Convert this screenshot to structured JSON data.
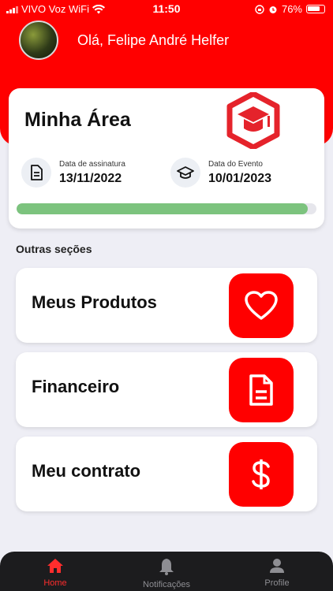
{
  "status_bar": {
    "carrier": "VIVO Voz WiFi",
    "time": "11:50",
    "battery": "76%"
  },
  "header": {
    "greeting": "Olá, Felipe André Helfer"
  },
  "main_card": {
    "title": "Minha Área",
    "subscription_label": "Data de assinatura",
    "subscription_date": "13/11/2022",
    "event_label": "Data do Evento",
    "event_date": "10/01/2023",
    "progress_fraction": 0.97
  },
  "sections": {
    "title": "Outras seções",
    "items": [
      {
        "label": "Meus Produtos",
        "icon": "heart-icon"
      },
      {
        "label": "Financeiro",
        "icon": "document-icon"
      },
      {
        "label": "Meu contrato",
        "icon": "dollar-icon"
      }
    ]
  },
  "tab_bar": {
    "items": [
      {
        "label": "Home",
        "icon": "home-icon",
        "active": true
      },
      {
        "label": "Notificações",
        "icon": "bell-icon",
        "active": false
      },
      {
        "label": "Profile",
        "icon": "person-icon",
        "active": false
      }
    ]
  },
  "colors": {
    "brand": "#ff0000",
    "progress": "#7cc37e",
    "tab_active": "#ff2d2d",
    "tab_inactive": "#8e8e93"
  }
}
